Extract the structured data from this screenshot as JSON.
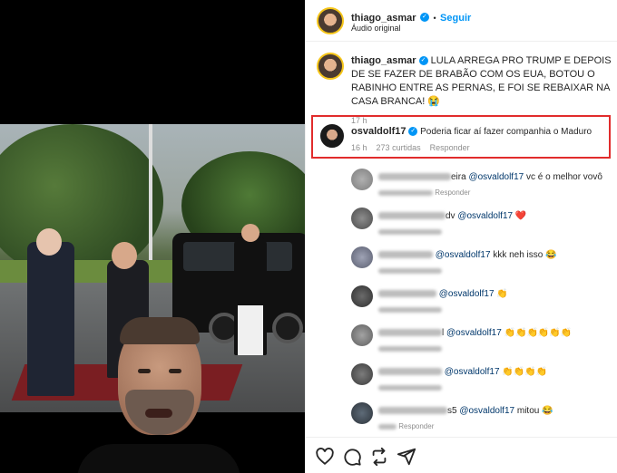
{
  "post": {
    "username": "thiago_asmar",
    "follow_label": "Seguir",
    "separator": "•",
    "audio": "Áudio original",
    "caption_text": "LULA ARREGA PRO TRUMP E DEPOIS DE SE FAZER DE BRABÃO COM OS EUA, BOTOU O RABINHO ENTRE AS PERNAS, E FOI SE REBAIXAR NA CASA BRANCA! 😭",
    "caption_time": "17 h"
  },
  "highlighted_comment": {
    "username": "osvaldolf17",
    "text": "Poderia ficar aí fazer companhia o Maduro",
    "time": "16 h",
    "likes": "273 curtidas",
    "reply_label": "Responder"
  },
  "replies": [
    {
      "name_tail": "eira",
      "mention": "@osvaldolf17",
      "text": "vc é o melhor vovô",
      "meta_tail": "Responder"
    },
    {
      "name_tail": "dv",
      "mention": "@osvaldolf17",
      "text": "❤️",
      "meta_tail": ""
    },
    {
      "name_tail": "",
      "mention": "@osvaldolf17",
      "text": "kkk neh isso 😂",
      "meta_tail": ""
    },
    {
      "name_tail": "",
      "mention": "@osvaldolf17",
      "text": "👏",
      "meta_tail": ""
    },
    {
      "name_tail": "l",
      "mention": "@osvaldolf17",
      "text": "👏👏👏👏👏👏",
      "meta_tail": ""
    },
    {
      "name_tail": "",
      "mention": "@osvaldolf17",
      "text": "👏👏👏👏",
      "meta_tail": ""
    },
    {
      "name_tail": "s5",
      "mention": "@osvaldolf17",
      "text": "mitou 😂",
      "meta_tail": "Responder"
    }
  ],
  "icons": [
    "heart-icon",
    "comment-icon",
    "repost-icon",
    "share-icon"
  ],
  "colors": {
    "link": "#0095f6",
    "mention": "#00376b",
    "highlight": "#e12c2c",
    "verified": "#0095f6"
  }
}
